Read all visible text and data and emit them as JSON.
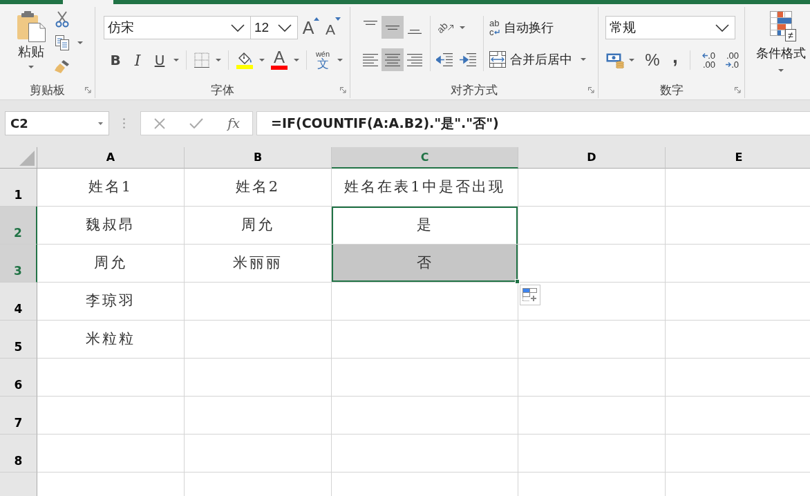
{
  "ribbon": {
    "clipboard": {
      "label": "剪贴板",
      "paste": "粘贴"
    },
    "font": {
      "label": "字体",
      "font_name": "仿宋",
      "font_size": "12",
      "grow": "A",
      "shrink": "A",
      "tools": [
        {
          "kind": "bold",
          "text": "B"
        },
        {
          "kind": "italic",
          "text": "I"
        },
        {
          "kind": "underline",
          "text": "U"
        },
        {
          "kind": "borders"
        },
        {
          "kind": "fill_color",
          "color": "#ffff00"
        },
        {
          "kind": "font_color",
          "text": "A",
          "color": "#ff0000"
        },
        {
          "kind": "phonetic",
          "text": [
            "wén",
            "文"
          ]
        }
      ]
    },
    "alignment": {
      "label": "对齐方式",
      "vertical": [
        {
          "kind": "top",
          "selected": false
        },
        {
          "kind": "middle",
          "selected": true
        },
        {
          "kind": "bottom",
          "selected": false
        }
      ],
      "horizontal": [
        {
          "kind": "left",
          "selected": false
        },
        {
          "kind": "center",
          "selected": true
        },
        {
          "kind": "right",
          "selected": false
        }
      ],
      "orientation": "ab",
      "wrap_text": {
        "icon_text": [
          "ab",
          "c"
        ],
        "label": "自动换行"
      },
      "merge": "合并后居中"
    },
    "number": {
      "label": "数字",
      "format": "常规",
      "percent": "%",
      "comma": ",",
      "increase_decimal": [
        ".0",
        ".00"
      ],
      "decrease_decimal": [
        ".00",
        ".0"
      ]
    },
    "styles": {
      "conditional_formatting": "条件格式",
      "symbol": "≠"
    }
  },
  "formula_bar": {
    "name_box": "C2",
    "function_button": "fx",
    "formula": "=IF(COUNTIF(A:A.B2).\"是\".\"否\")"
  },
  "grid": {
    "columns": [
      {
        "label": "A",
        "selected": false
      },
      {
        "label": "B",
        "selected": false
      },
      {
        "label": "C",
        "selected": true
      },
      {
        "label": "D",
        "selected": false
      },
      {
        "label": "E",
        "selected": false
      }
    ],
    "rows": [
      {
        "number": "1",
        "selected": false,
        "cells": [
          {
            "text": "姓名1",
            "selected": false
          },
          {
            "text": "姓名2",
            "selected": false
          },
          {
            "text": "姓名在表1中是否出现",
            "selected": false
          }
        ]
      },
      {
        "number": "2",
        "selected": true,
        "cells": [
          {
            "text": "魏叔昂",
            "selected": false
          },
          {
            "text": "周允",
            "selected": false
          },
          {
            "text": "是",
            "selected": true
          }
        ]
      },
      {
        "number": "3",
        "selected": true,
        "cells": [
          {
            "text": "周允",
            "selected": false
          },
          {
            "text": "米丽丽",
            "selected": false
          },
          {
            "text": "否",
            "selected": true
          }
        ]
      },
      {
        "number": "4",
        "selected": false,
        "cells": [
          {
            "text": "李琼羽",
            "selected": false
          }
        ]
      },
      {
        "number": "5",
        "selected": false,
        "cells": [
          {
            "text": "米粒粒",
            "selected": false
          }
        ]
      },
      {
        "number": "6",
        "selected": false
      },
      {
        "number": "7",
        "selected": false
      },
      {
        "number": "8",
        "selected": false
      },
      {
        "selected": false
      }
    ]
  },
  "quick_analysis": true
}
